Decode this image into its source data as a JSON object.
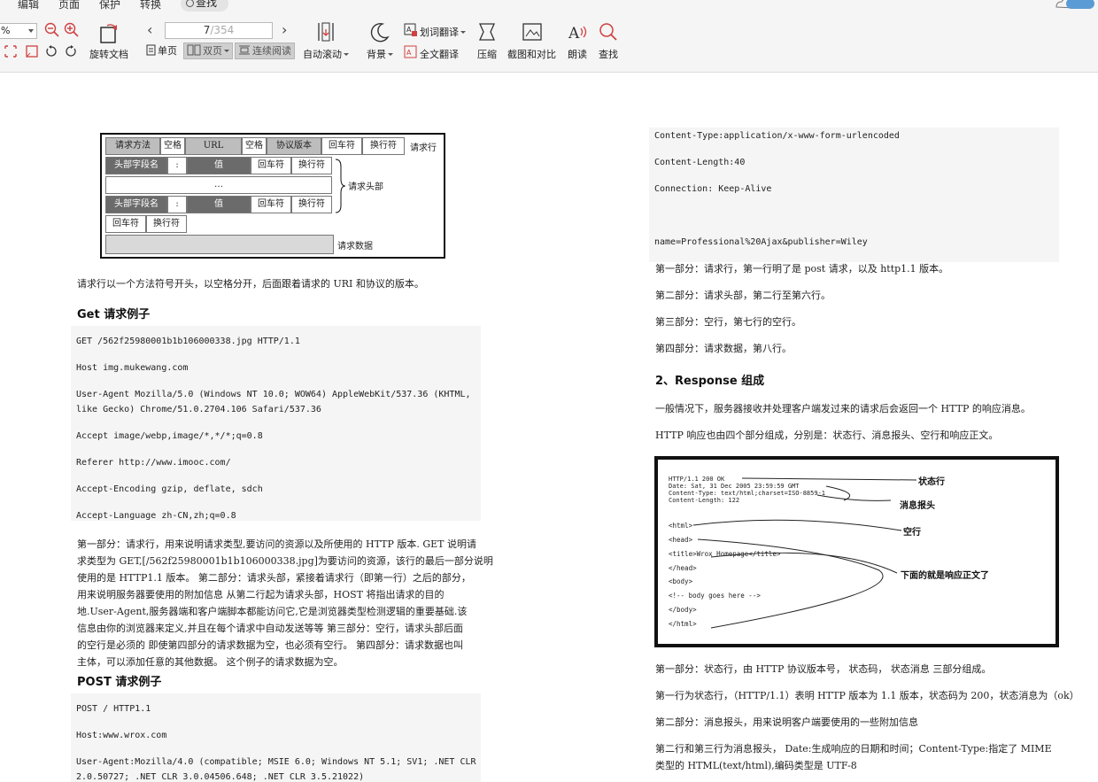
{
  "menu": {
    "items": [
      "编辑",
      "页面",
      "保护",
      "转换"
    ],
    "search_label": "查找"
  },
  "toolbar": {
    "zoom_value": "%",
    "rotate_label": "旋转文档",
    "page_current": "7",
    "page_total": "/354",
    "single_label": "单页",
    "double_label": "双页",
    "continuous_label": "连续阅读",
    "autoscroll_label": "自动滚动",
    "background_label": "背景",
    "word_translate_label": "划词翻译",
    "full_translate_label": "全文翻译",
    "compress_label": "压缩",
    "screenshot_label": "截图和对比",
    "read_aloud_label": "朗读",
    "find_label": "查找"
  },
  "left": {
    "diagram": {
      "row1": [
        "请求方法",
        "空格",
        "URL",
        "空格",
        "协议版本",
        "回车符",
        "换行符"
      ],
      "row1_label": "请求行",
      "header_row": [
        "头部字段名",
        ":",
        "值",
        "回车符",
        "换行符"
      ],
      "ellipsis": "…",
      "brace_label": "请求头部",
      "blank_row": [
        "回车符",
        "换行符"
      ],
      "body_label": "请求数据"
    },
    "intro": "请求行以一个方法符号开头，以空格分开，后面跟着请求的 URI 和协议的版本。",
    "get_heading": "Get 请求例子",
    "get_code": [
      "GET /562f25980001b1b106000338.jpg HTTP/1.1",
      "Host    img.mukewang.com",
      "User-Agent  Mozilla/5.0 (Windows NT 10.0; WOW64) AppleWebKit/537.36 (KHTML,",
      "like Gecko) Chrome/51.0.2704.106 Safari/537.36",
      "Accept  image/webp,image/*,*/*;q=0.8",
      "Referer http://www.imooc.com/",
      "Accept-Encoding gzip, deflate, sdch",
      "Accept-Language zh-CN,zh;q=0.8"
    ],
    "get_explain": [
      "第一部分：请求行，用来说明请求类型,要访问的资源以及所使用的 HTTP 版本. GET 说明请",
      "求类型为 GET,[/562f25980001b1b106000338.jpg]为要访问的资源，该行的最后一部分说明",
      "使用的是 HTTP1.1 版本。 第二部分：请求头部，紧接着请求行（即第一行）之后的部分，",
      "用来说明服务器要使用的附加信息  从第二行起为请求头部，HOST 将指出请求的目的",
      "地.User-Agent,服务器端和客户端脚本都能访问它,它是浏览器类型检测逻辑的重要基础.该",
      "信息由你的浏览器来定义,并且在每个请求中自动发送等等  第三部分：空行，请求头部后面",
      "的空行是必须的  即使第四部分的请求数据为空，也必须有空行。 第四部分：请求数据也叫",
      "主体，可以添加任意的其他数据。  这个例子的请求数据为空。"
    ],
    "post_heading": "POST 请求例子",
    "post_code": [
      "POST / HTTP1.1",
      "Host:www.wrox.com",
      "User-Agent:Mozilla/4.0 (compatible; MSIE 6.0; Windows NT 5.1; SV1; .NET CLR",
      "2.0.50727; .NET CLR 3.0.04506.648; .NET CLR 3.5.21022)"
    ]
  },
  "right": {
    "post_code": [
      "Content-Type:application/x-www-form-urlencoded",
      "Content-Length:40",
      "Connection: Keep-Alive",
      "",
      "name=Professional%20Ajax&publisher=Wiley"
    ],
    "post_explain": [
      "第一部分：请求行，第一行明了是 post 请求，以及 http1.1 版本。",
      "第二部分：请求头部，第二行至第六行。",
      "第三部分：空行，第七行的空行。",
      "第四部分：请求数据，第八行。"
    ],
    "response_heading": "2、Response 组成",
    "response_intro": "一般情况下，服务器接收并处理客户端发过来的请求后会返回一个 HTTP 的响应消息。",
    "response_parts": "HTTP 响应也由四个部分组成，分别是：状态行、消息报头、空行和响应正文。",
    "diagram": {
      "header_lines": [
        "HTTP/1.1 200 OK",
        "Date: Sat, 31 Dec 2005 23:59:59 GMT",
        "Content-Type: text/html;charset=ISO-8859-1",
        "Content-Length: 122"
      ],
      "body_lines": [
        "<html>",
        "<head>",
        "<title>Wrox Homepage</title>",
        "</head>",
        "<body>",
        "<!-- body goes here -->",
        "</body>",
        "</html>"
      ],
      "label_status": "状态行",
      "label_headers": "消息报头",
      "label_blank": "空行",
      "label_body": "下面的就是响应正文了"
    },
    "after": [
      "第一部分：状态行，由 HTTP 协议版本号， 状态码， 状态消息 三部分组成。",
      "第一行为状态行，（HTTP/1.1）表明 HTTP 版本为 1.1 版本，状态码为 200，状态消息为（ok）",
      "第二部分：消息报头，用来说明客户端要使用的一些附加信息",
      "第二行和第三行为消息报头， Date:生成响应的日期和时间；Content-Type:指定了 MIME",
      "类型的 HTML(text/html),编码类型是 UTF-8"
    ]
  }
}
